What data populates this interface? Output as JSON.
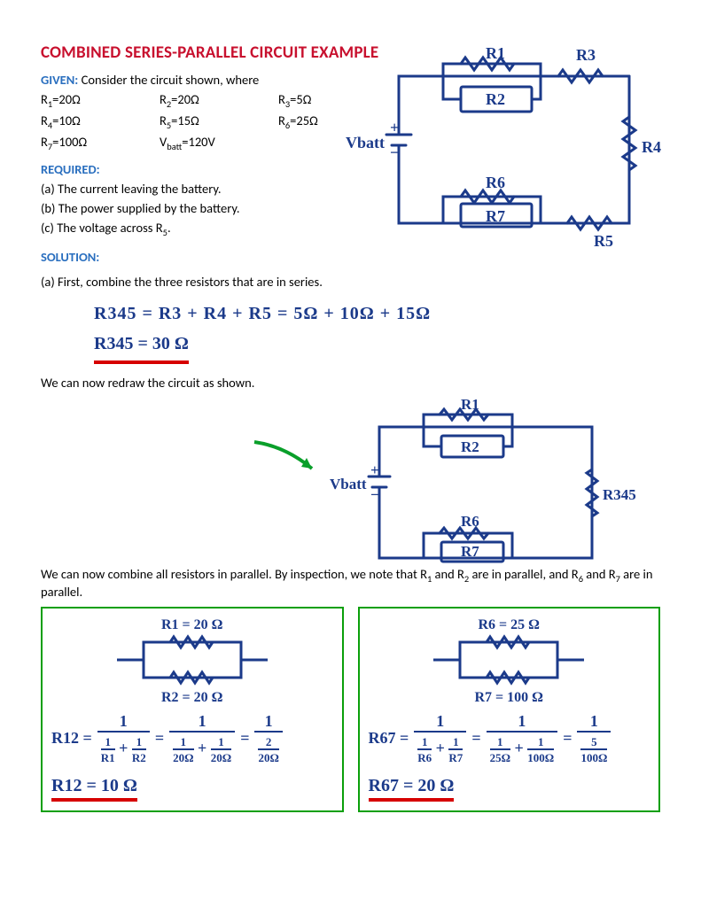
{
  "title": "COMBINED SERIES-PARALLEL CIRCUIT EXAMPLE",
  "given_label": "GIVEN:",
  "given_text": " Consider the circuit shown, where",
  "vals": {
    "r1": "R1=20Ω",
    "r2": "R2=20Ω",
    "r3": "R3=5Ω",
    "r4": "R4=10Ω",
    "r5": "R5=15Ω",
    "r6": "R6=25Ω",
    "r7": "R7=100Ω",
    "vb": "Vbatt=120V"
  },
  "required_label": "REQUIRED:",
  "req_a": "(a) The current leaving the battery.",
  "req_b": "(b) The power supplied by the battery.",
  "req_c": "(c) The voltage across R5.",
  "solution_label": "SOLUTION:",
  "sol_a_intro": "(a) First, combine the three resistors that are in series.",
  "eq1": "R345  =  R3 + R4 + R5  =  5Ω + 10Ω + 15Ω",
  "eq1b": "R345 =   30 Ω",
  "redraw": "We can now redraw the circuit as shown.",
  "para_text": "We can now combine all resistors in parallel. By inspection, we note that R1 and R2 are in parallel, and R6 and R7 are in parallel.",
  "circ_labels": {
    "Vbatt": "Vbatt",
    "R1": "R1",
    "R2": "R2",
    "R3": "R3",
    "R4": "R4",
    "R5": "R5",
    "R6": "R6",
    "R7": "R7",
    "R345": "R345"
  },
  "box_left": {
    "top": "R1 = 20 Ω",
    "bot": "R2 = 20 Ω",
    "lhs": "R12 =",
    "t_num": "1",
    "t_den1": "1",
    "t_den1d": "R1",
    "t_plus": " + ",
    "t_den2": "1",
    "t_den2d": "R2",
    "m_num": "1",
    "m_d1": "1",
    "m_d1d": "20Ω",
    "m_d2": "1",
    "m_d2d": "20Ω",
    "r_num": "1",
    "r_dn": "2",
    "r_dd": "20Ω",
    "ans": "R12 =  10 Ω"
  },
  "box_right": {
    "top": "R6 = 25 Ω",
    "bot": "R7 = 100 Ω",
    "lhs": "R67 =",
    "t_num": "1",
    "t_den1": "1",
    "t_den1d": "R6",
    "t_plus": " + ",
    "t_den2": "1",
    "t_den2d": "R7",
    "m_num": "1",
    "m_d1": "1",
    "m_d1d": "25Ω",
    "m_d2": "1",
    "m_d2d": "100Ω",
    "r_num": "1",
    "r_dn": "5",
    "r_dd": "100Ω",
    "ans": "R67 =  20 Ω"
  }
}
